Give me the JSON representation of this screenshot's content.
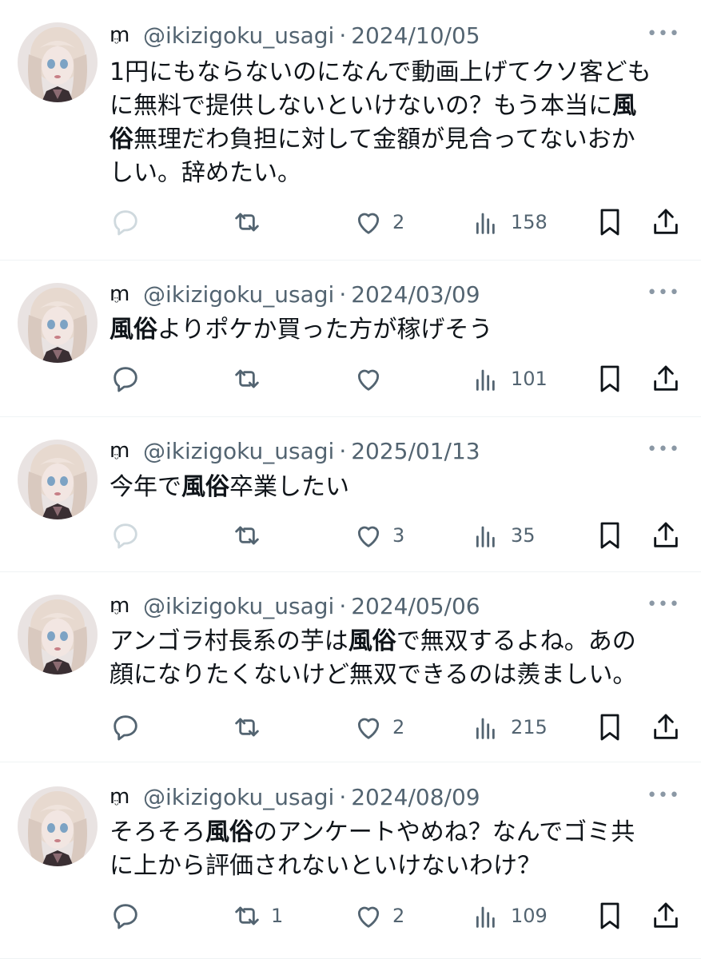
{
  "tweets": [
    {
      "handle": "@ikizigoku_usagi",
      "separator": "·",
      "date": "2024/10/05",
      "lines": [
        [
          {
            "t": "1円にもならないのになんで動画上げてクソ客ども"
          }
        ],
        [
          {
            "t": "に無料で提供しないといけないの？もう本当に"
          },
          {
            "t": "風",
            "b": true
          }
        ],
        [
          {
            "t": "俗",
            "b": true
          },
          {
            "t": "無理だわ負担に対して金額が見合ってないおか"
          }
        ],
        [
          {
            "t": "しい。辞めたい。"
          }
        ]
      ],
      "reply_count": "",
      "retweet_count": "",
      "like_count": "2",
      "view_count": "158",
      "reply_faded": true
    },
    {
      "handle": "@ikizigoku_usagi",
      "separator": "·",
      "date": "2024/03/09",
      "lines": [
        [
          {
            "t": "風俗",
            "b": true
          },
          {
            "t": "よりポケか買った方が稼げそう"
          }
        ]
      ],
      "reply_count": "",
      "retweet_count": "",
      "like_count": "",
      "view_count": "101",
      "reply_faded": false
    },
    {
      "handle": "@ikizigoku_usagi",
      "separator": "·",
      "date": "2025/01/13",
      "lines": [
        [
          {
            "t": "今年で"
          },
          {
            "t": "風俗",
            "b": true
          },
          {
            "t": "卒業したい"
          }
        ]
      ],
      "reply_count": "",
      "retweet_count": "",
      "like_count": "3",
      "view_count": "35",
      "reply_faded": true
    },
    {
      "handle": "@ikizigoku_usagi",
      "separator": "·",
      "date": "2024/05/06",
      "lines": [
        [
          {
            "t": "アンゴラ村長系の芋は"
          },
          {
            "t": "風俗",
            "b": true
          },
          {
            "t": "で無双するよね。あの"
          }
        ],
        [
          {
            "t": "顔になりたくないけど無双できるのは羨ましい。"
          }
        ]
      ],
      "reply_count": "",
      "retweet_count": "",
      "like_count": "2",
      "view_count": "215",
      "reply_faded": false
    },
    {
      "handle": "@ikizigoku_usagi",
      "separator": "·",
      "date": "2024/08/09",
      "lines": [
        [
          {
            "t": "そろそろ"
          },
          {
            "t": "風俗",
            "b": true
          },
          {
            "t": "のアンケートやめね？なんでゴミ共"
          }
        ],
        [
          {
            "t": "に上から評価されないといけないわけ？"
          }
        ]
      ],
      "reply_count": "",
      "retweet_count": "1",
      "like_count": "2",
      "view_count": "109",
      "reply_faded": false
    }
  ],
  "display_name_glyph": "m",
  "display_name_smile": "ᵕ̈",
  "more_glyph": "•••",
  "colors": {
    "text": "#0f1419",
    "muted": "#536471",
    "divider": "#eff3f4",
    "faded": "#cfd9de"
  }
}
